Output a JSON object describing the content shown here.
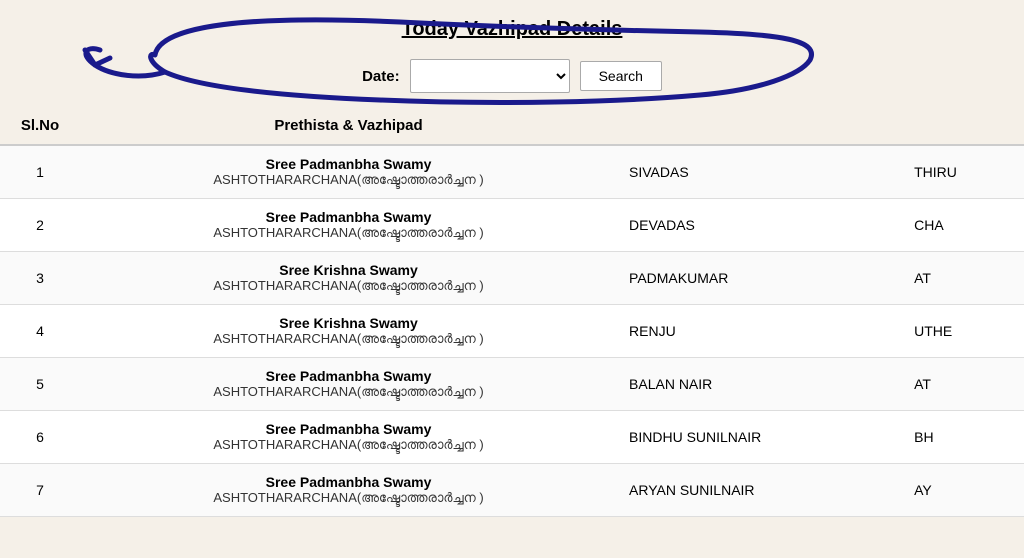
{
  "page": {
    "title": "Today Vazhipad Details",
    "date_label": "Date:",
    "search_button_label": "Search",
    "date_select_placeholder": ""
  },
  "table": {
    "headers": [
      "Sl.No",
      "Prethista & Vazhipad",
      "",
      ""
    ],
    "rows": [
      {
        "slno": "1",
        "deity": "Sree Padmanbha Swamy",
        "vazhipad": "ASHTOTHARARCHANA(അഷ്ടോത്തരാർച്ചന )",
        "name": "SIVADAS",
        "extra": "THIRU"
      },
      {
        "slno": "2",
        "deity": "Sree Padmanbha Swamy",
        "vazhipad": "ASHTOTHARARCHANA(അഷ്ടോത്തരാർച്ചന )",
        "name": "DEVADAS",
        "extra": "CHA"
      },
      {
        "slno": "3",
        "deity": "Sree Krishna Swamy",
        "vazhipad": "ASHTOTHARARCHANA(അഷ്ടോത്തരാർച്ചന )",
        "name": "PADMAKUMAR",
        "extra": "AT"
      },
      {
        "slno": "4",
        "deity": "Sree Krishna Swamy",
        "vazhipad": "ASHTOTHARARCHANA(അഷ്ടോത്തരാർച്ചന )",
        "name": "RENJU",
        "extra": "UTHE"
      },
      {
        "slno": "5",
        "deity": "Sree Padmanbha Swamy",
        "vazhipad": "ASHTOTHARARCHANA(അഷ്ടോത്തരാർച്ചന )",
        "name": "BALAN NAIR",
        "extra": "AT"
      },
      {
        "slno": "6",
        "deity": "Sree Padmanbha Swamy",
        "vazhipad": "ASHTOTHARARCHANA(അഷ്ടോത്തരാർച്ചന )",
        "name": "BINDHU SUNILNAIR",
        "extra": "BH"
      },
      {
        "slno": "7",
        "deity": "Sree Padmanbha Swamy",
        "vazhipad": "ASHTOTHARARCHANA(അഷ്ടോത്തരാർച്ചന )",
        "name": "ARYAN SUNILNAIR",
        "extra": "AY"
      }
    ]
  }
}
